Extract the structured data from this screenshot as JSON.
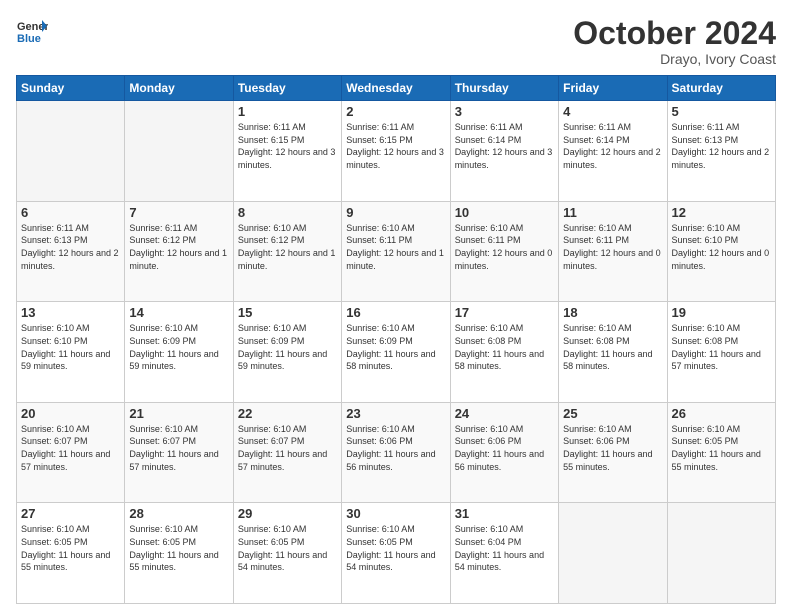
{
  "logo": {
    "line1": "General",
    "line2": "Blue"
  },
  "header": {
    "month": "October 2024",
    "location": "Drayo, Ivory Coast"
  },
  "weekdays": [
    "Sunday",
    "Monday",
    "Tuesday",
    "Wednesday",
    "Thursday",
    "Friday",
    "Saturday"
  ],
  "weeks": [
    [
      {
        "day": "",
        "info": ""
      },
      {
        "day": "",
        "info": ""
      },
      {
        "day": "1",
        "info": "Sunrise: 6:11 AM\nSunset: 6:15 PM\nDaylight: 12 hours and 3 minutes."
      },
      {
        "day": "2",
        "info": "Sunrise: 6:11 AM\nSunset: 6:15 PM\nDaylight: 12 hours and 3 minutes."
      },
      {
        "day": "3",
        "info": "Sunrise: 6:11 AM\nSunset: 6:14 PM\nDaylight: 12 hours and 3 minutes."
      },
      {
        "day": "4",
        "info": "Sunrise: 6:11 AM\nSunset: 6:14 PM\nDaylight: 12 hours and 2 minutes."
      },
      {
        "day": "5",
        "info": "Sunrise: 6:11 AM\nSunset: 6:13 PM\nDaylight: 12 hours and 2 minutes."
      }
    ],
    [
      {
        "day": "6",
        "info": "Sunrise: 6:11 AM\nSunset: 6:13 PM\nDaylight: 12 hours and 2 minutes."
      },
      {
        "day": "7",
        "info": "Sunrise: 6:11 AM\nSunset: 6:12 PM\nDaylight: 12 hours and 1 minute."
      },
      {
        "day": "8",
        "info": "Sunrise: 6:10 AM\nSunset: 6:12 PM\nDaylight: 12 hours and 1 minute."
      },
      {
        "day": "9",
        "info": "Sunrise: 6:10 AM\nSunset: 6:11 PM\nDaylight: 12 hours and 1 minute."
      },
      {
        "day": "10",
        "info": "Sunrise: 6:10 AM\nSunset: 6:11 PM\nDaylight: 12 hours and 0 minutes."
      },
      {
        "day": "11",
        "info": "Sunrise: 6:10 AM\nSunset: 6:11 PM\nDaylight: 12 hours and 0 minutes."
      },
      {
        "day": "12",
        "info": "Sunrise: 6:10 AM\nSunset: 6:10 PM\nDaylight: 12 hours and 0 minutes."
      }
    ],
    [
      {
        "day": "13",
        "info": "Sunrise: 6:10 AM\nSunset: 6:10 PM\nDaylight: 11 hours and 59 minutes."
      },
      {
        "day": "14",
        "info": "Sunrise: 6:10 AM\nSunset: 6:09 PM\nDaylight: 11 hours and 59 minutes."
      },
      {
        "day": "15",
        "info": "Sunrise: 6:10 AM\nSunset: 6:09 PM\nDaylight: 11 hours and 59 minutes."
      },
      {
        "day": "16",
        "info": "Sunrise: 6:10 AM\nSunset: 6:09 PM\nDaylight: 11 hours and 58 minutes."
      },
      {
        "day": "17",
        "info": "Sunrise: 6:10 AM\nSunset: 6:08 PM\nDaylight: 11 hours and 58 minutes."
      },
      {
        "day": "18",
        "info": "Sunrise: 6:10 AM\nSunset: 6:08 PM\nDaylight: 11 hours and 58 minutes."
      },
      {
        "day": "19",
        "info": "Sunrise: 6:10 AM\nSunset: 6:08 PM\nDaylight: 11 hours and 57 minutes."
      }
    ],
    [
      {
        "day": "20",
        "info": "Sunrise: 6:10 AM\nSunset: 6:07 PM\nDaylight: 11 hours and 57 minutes."
      },
      {
        "day": "21",
        "info": "Sunrise: 6:10 AM\nSunset: 6:07 PM\nDaylight: 11 hours and 57 minutes."
      },
      {
        "day": "22",
        "info": "Sunrise: 6:10 AM\nSunset: 6:07 PM\nDaylight: 11 hours and 57 minutes."
      },
      {
        "day": "23",
        "info": "Sunrise: 6:10 AM\nSunset: 6:06 PM\nDaylight: 11 hours and 56 minutes."
      },
      {
        "day": "24",
        "info": "Sunrise: 6:10 AM\nSunset: 6:06 PM\nDaylight: 11 hours and 56 minutes."
      },
      {
        "day": "25",
        "info": "Sunrise: 6:10 AM\nSunset: 6:06 PM\nDaylight: 11 hours and 55 minutes."
      },
      {
        "day": "26",
        "info": "Sunrise: 6:10 AM\nSunset: 6:05 PM\nDaylight: 11 hours and 55 minutes."
      }
    ],
    [
      {
        "day": "27",
        "info": "Sunrise: 6:10 AM\nSunset: 6:05 PM\nDaylight: 11 hours and 55 minutes."
      },
      {
        "day": "28",
        "info": "Sunrise: 6:10 AM\nSunset: 6:05 PM\nDaylight: 11 hours and 55 minutes."
      },
      {
        "day": "29",
        "info": "Sunrise: 6:10 AM\nSunset: 6:05 PM\nDaylight: 11 hours and 54 minutes."
      },
      {
        "day": "30",
        "info": "Sunrise: 6:10 AM\nSunset: 6:05 PM\nDaylight: 11 hours and 54 minutes."
      },
      {
        "day": "31",
        "info": "Sunrise: 6:10 AM\nSunset: 6:04 PM\nDaylight: 11 hours and 54 minutes."
      },
      {
        "day": "",
        "info": ""
      },
      {
        "day": "",
        "info": ""
      }
    ]
  ]
}
